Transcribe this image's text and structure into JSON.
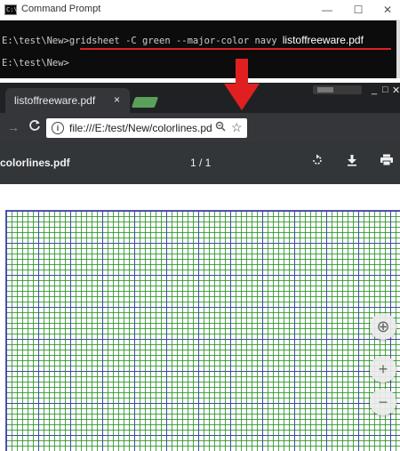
{
  "cmd": {
    "title": "Command Prompt",
    "icon_text": "C:\\",
    "controls": {
      "minimize": "—",
      "maximize": "☐",
      "close": "✕"
    },
    "line1_prompt": "E:\\test\\New>",
    "line1_command": "gridsheet -C green --major-color navy",
    "line1_suffix": "listoffreeware.pdf",
    "line2_prompt": "E:\\test\\New>"
  },
  "browser": {
    "tab_title": "listoffreeware.pdf",
    "tab_close": "×",
    "window_controls": {
      "minimize": "_",
      "maximize": "□",
      "close": "✕"
    },
    "url": "file:///E:/test/New/colorlines.pdf",
    "icons": {
      "forward": "forward-arrow-icon",
      "reload": "reload-icon",
      "info": "info-icon",
      "zoom": "zoom-icon",
      "star": "star-icon"
    }
  },
  "pdf": {
    "title": "colorlines.pdf",
    "page_indicator": "1 / 1",
    "icons": {
      "rotate": "rotate-icon",
      "download": "download-icon",
      "print": "print-icon"
    },
    "fit_button": "⊕",
    "zoom_in": "+",
    "zoom_out": "−",
    "grid": {
      "minor_color": "#2a8c2a",
      "major_color": "#3c3cb4"
    }
  },
  "colors": {
    "arrow": "#e02020",
    "underline": "#e02020",
    "pdf_toolbar": "#323639",
    "chrome_bg": "#202124"
  }
}
